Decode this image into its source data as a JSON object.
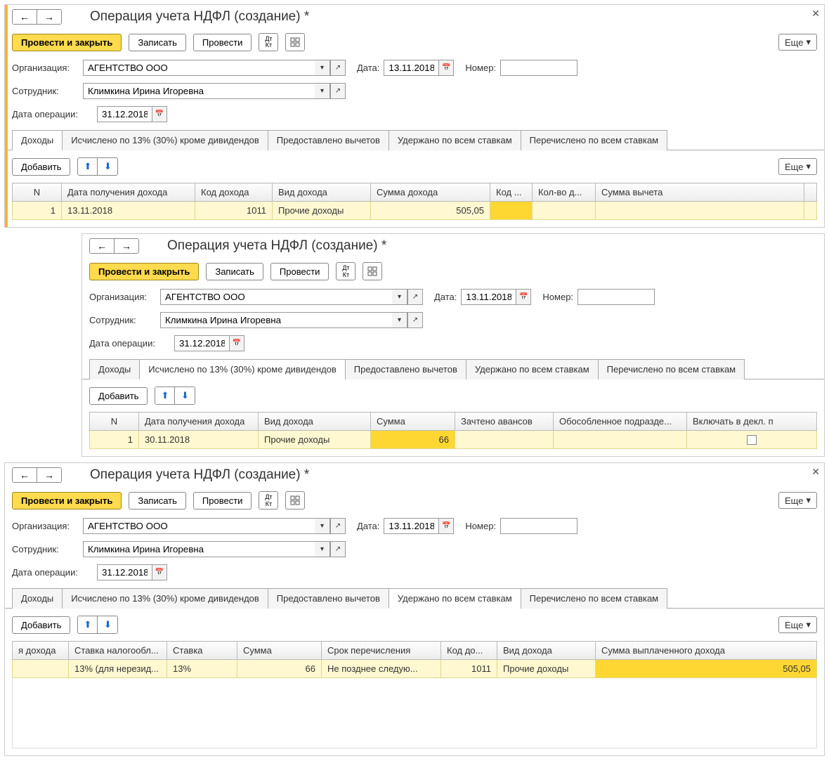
{
  "common": {
    "title": "Операция учета НДФЛ (создание) *",
    "post_close": "Провести и закрыть",
    "write": "Записать",
    "post": "Провести",
    "more": "Еще",
    "org_lbl": "Организация:",
    "org": "АГЕНТСТВО ООО",
    "emp_lbl": "Сотрудник:",
    "emp": "Климкина Ирина Игоревна",
    "opdate_lbl": "Дата операции:",
    "opdate": "31.12.2018",
    "date_lbl": "Дата:",
    "date": "13.11.2018",
    "num_lbl": "Номер:",
    "num": "",
    "add": "Добавить",
    "dtkt": "Дт\nКт"
  },
  "tabs": {
    "t1": "Доходы",
    "t2": "Исчислено по 13% (30%) кроме дивидендов",
    "t3": "Предоставлено вычетов",
    "t4": "Удержано по всем ставкам",
    "t5": "Перечислено по всем ставкам"
  },
  "w1": {
    "headers": {
      "n": "N",
      "d": "Дата получения дохода",
      "code": "Код дохода",
      "type": "Вид дохода",
      "sum": "Сумма дохода",
      "dcode": "Код ...",
      "cnt": "Кол-во д...",
      "ded": "Сумма вычета"
    },
    "row": {
      "n": "1",
      "d": "13.11.2018",
      "code": "1011",
      "type": "Прочие доходы",
      "sum": "505,05"
    }
  },
  "w2": {
    "headers": {
      "n": "N",
      "d": "Дата получения дохода",
      "type": "Вид дохода",
      "sum": "Сумма",
      "adv": "Зачтено авансов",
      "dep": "Обособленное подразде...",
      "incl": "Включать в декл. п"
    },
    "row": {
      "n": "1",
      "d": "30.11.2018",
      "type": "Прочие доходы",
      "sum": "66"
    }
  },
  "w3": {
    "headers": {
      "a": "я дохода",
      "rate": "Ставка налогообл...",
      "ratep": "Ставка",
      "sum": "Сумма",
      "term": "Срок перечисления",
      "code": "Код до...",
      "type": "Вид дохода",
      "paid": "Сумма выплаченного дохода"
    },
    "row": {
      "rate": "13% (для нерезид...",
      "ratep": "13%",
      "sum": "66",
      "term": "Не позднее следую...",
      "code": "1011",
      "type": "Прочие доходы",
      "paid": "505,05"
    }
  }
}
